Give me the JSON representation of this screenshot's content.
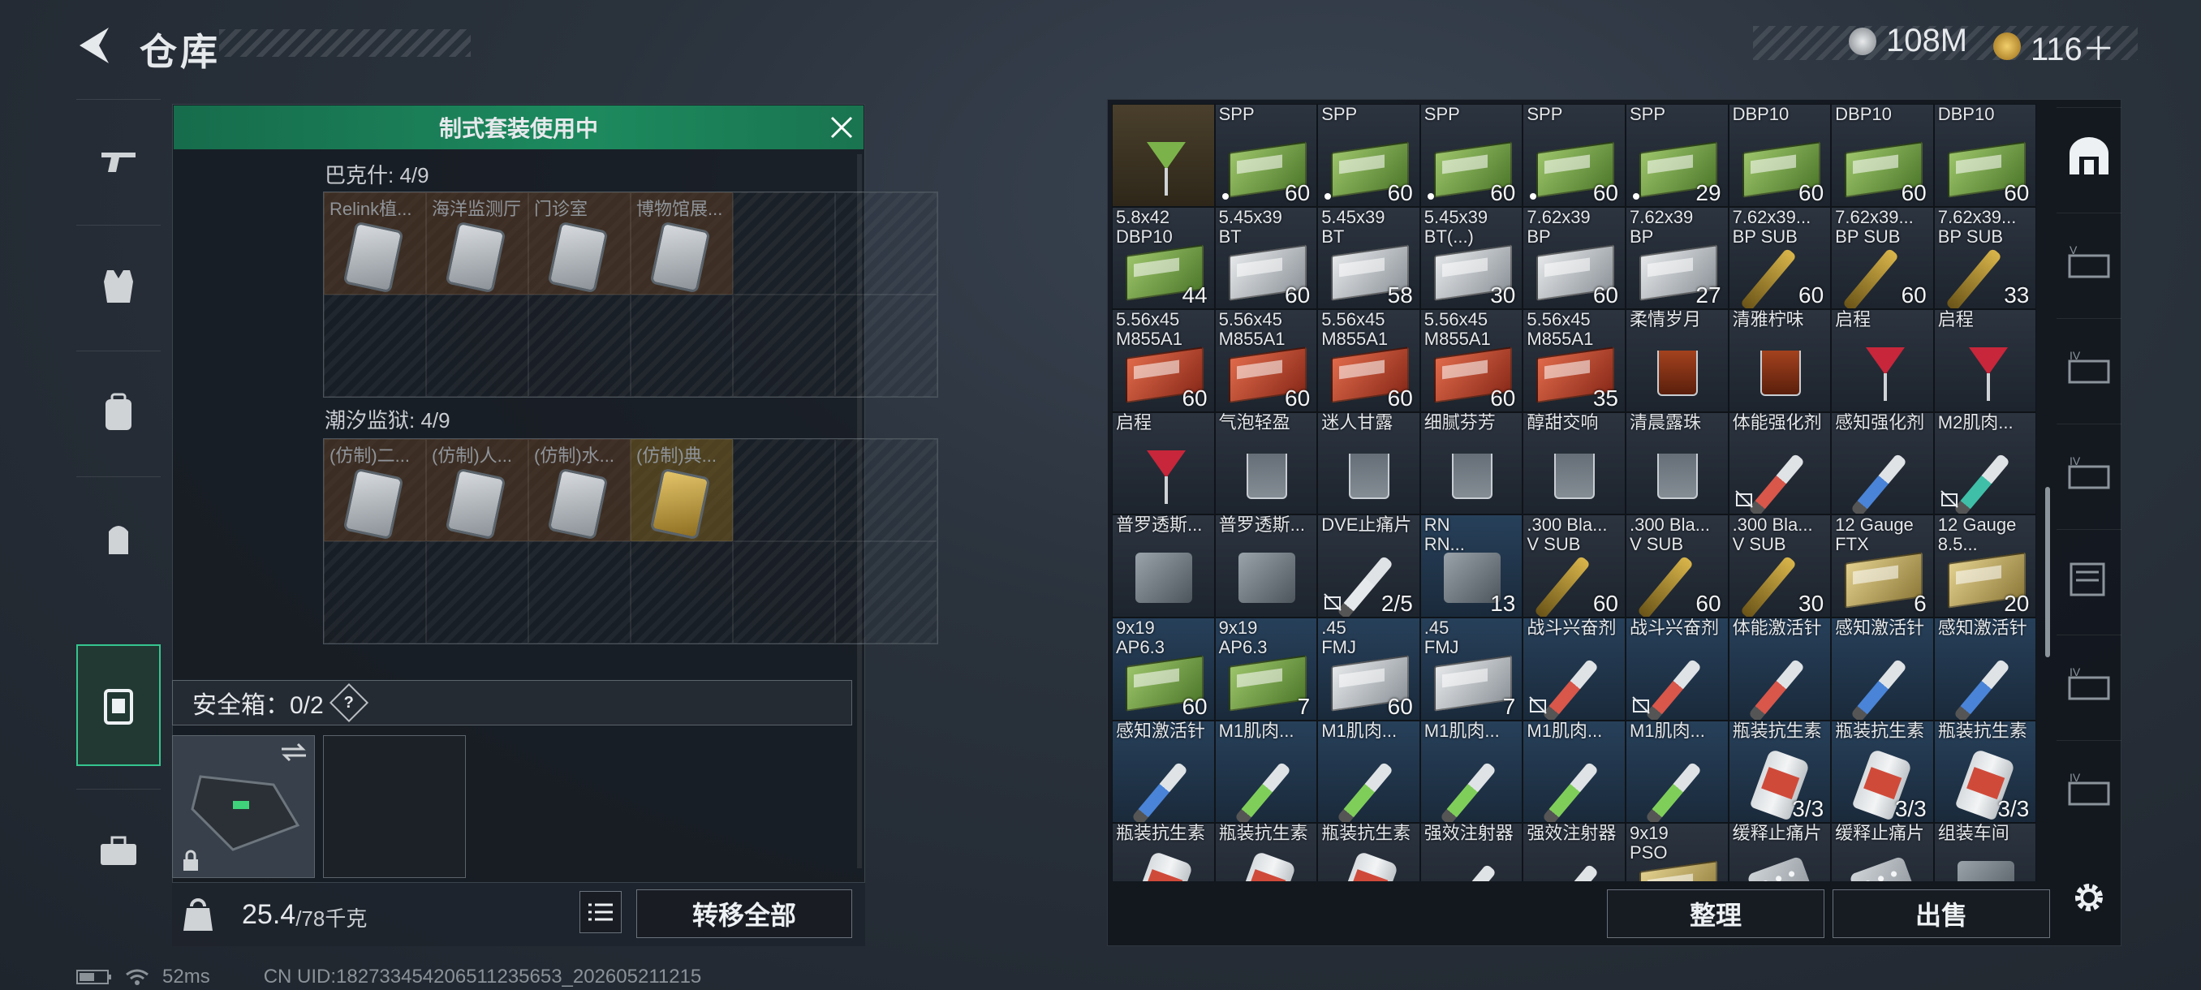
{
  "header": {
    "title": "仓库",
    "currency_silver": "108M",
    "currency_gold": "116＋"
  },
  "left_nav": [
    "gun-icon",
    "vest-icon",
    "backpack-icon",
    "pouch-icon",
    "secure-case-icon",
    "toolbox-icon"
  ],
  "kit_panel": {
    "title": "制式套装使用中",
    "set1": {
      "label": "巴克什: 4/9",
      "items": [
        "Relink植...",
        "海洋监测厅",
        "门诊室",
        "博物馆展..."
      ]
    },
    "set2": {
      "label": "潮汐监狱: 4/9",
      "items": [
        "(仿制)二...",
        "(仿制)人...",
        "(仿制)水...",
        "(仿制)典..."
      ]
    }
  },
  "safe_box": {
    "label": "安全箱：0/2",
    "help": "?"
  },
  "weight": {
    "current": "25.4",
    "max": "/78千克"
  },
  "buttons": {
    "transfer_all": "转移全部",
    "sort": "整理",
    "sell": "出售"
  },
  "grid": [
    {
      "n": "",
      "c": "",
      "t": "cocktail-green",
      "bg": "brown"
    },
    {
      "n": "SPP",
      "c": "60",
      "t": "ammo-green",
      "dot": true
    },
    {
      "n": "SPP",
      "c": "60",
      "t": "ammo-green",
      "dot": true
    },
    {
      "n": "SPP",
      "c": "60",
      "t": "ammo-green",
      "dot": true
    },
    {
      "n": "SPP",
      "c": "60",
      "t": "ammo-green",
      "dot": true
    },
    {
      "n": "SPP",
      "c": "29",
      "t": "ammo-green",
      "dot": true
    },
    {
      "n": "DBP10",
      "c": "60",
      "t": "ammo-green"
    },
    {
      "n": "DBP10",
      "c": "60",
      "t": "ammo-green"
    },
    {
      "n": "DBP10",
      "c": "60",
      "t": "ammo-green"
    },
    {
      "n": "5.8x42\nDBP10",
      "c": "44",
      "t": "ammo-green"
    },
    {
      "n": "5.45x39\nBT",
      "c": "60",
      "t": "ammo-white"
    },
    {
      "n": "5.45x39\nBT",
      "c": "58",
      "t": "ammo-white"
    },
    {
      "n": "5.45x39\nBT(...)",
      "c": "30",
      "t": "ammo-white"
    },
    {
      "n": "7.62x39\nBP",
      "c": "60",
      "t": "ammo-white"
    },
    {
      "n": "7.62x39\nBP",
      "c": "27",
      "t": "ammo-white"
    },
    {
      "n": "7.62x39...\nBP SUB",
      "c": "60",
      "t": "shell"
    },
    {
      "n": "7.62x39...\nBP SUB",
      "c": "60",
      "t": "shell"
    },
    {
      "n": "7.62x39...\nBP SUB",
      "c": "33",
      "t": "shell"
    },
    {
      "n": "5.56x45\nM855A1",
      "c": "60",
      "t": "ammo-red"
    },
    {
      "n": "5.56x45\nM855A1",
      "c": "60",
      "t": "ammo-red"
    },
    {
      "n": "5.56x45\nM855A1",
      "c": "60",
      "t": "ammo-red"
    },
    {
      "n": "5.56x45\nM855A1",
      "c": "60",
      "t": "ammo-red"
    },
    {
      "n": "5.56x45\nM855A1",
      "c": "35",
      "t": "ammo-red"
    },
    {
      "n": "柔情岁月",
      "c": "",
      "t": "tumbler-amber"
    },
    {
      "n": "清雅柠味",
      "c": "",
      "t": "tumbler-amber"
    },
    {
      "n": "启程",
      "c": "",
      "t": "cocktail"
    },
    {
      "n": "启程",
      "c": "",
      "t": "cocktail"
    },
    {
      "n": "启程",
      "c": "",
      "t": "cocktail"
    },
    {
      "n": "气泡轻盈",
      "c": "",
      "t": "tumbler"
    },
    {
      "n": "迷人甘露",
      "c": "",
      "t": "tumbler"
    },
    {
      "n": "细腻芬芳",
      "c": "",
      "t": "tumbler"
    },
    {
      "n": "醇甜交响",
      "c": "",
      "t": "tumbler"
    },
    {
      "n": "清晨露珠",
      "c": "",
      "t": "tumbler"
    },
    {
      "n": "体能强化剂",
      "c": "",
      "t": "syringe-red",
      "lock": true
    },
    {
      "n": "感知强化剂",
      "c": "",
      "t": "syringe-blue"
    },
    {
      "n": "M2肌肉...",
      "c": "",
      "t": "syringe-teal",
      "lock": true
    },
    {
      "n": "普罗透斯...",
      "c": "",
      "t": "generic"
    },
    {
      "n": "普罗透斯...",
      "c": "",
      "t": "generic"
    },
    {
      "n": "DVE止痛片",
      "c": "2/5",
      "t": "syringe-white",
      "lock": true
    },
    {
      "n": "RN\nRN...",
      "c": "13",
      "t": "generic",
      "bg": "blue"
    },
    {
      "n": ".300 Bla...\nV SUB",
      "c": "60",
      "t": "shell"
    },
    {
      "n": ".300 Bla...\nV SUB",
      "c": "60",
      "t": "shell"
    },
    {
      "n": ".300 Bla...\nV SUB",
      "c": "30",
      "t": "shell"
    },
    {
      "n": "12 Gauge\nFTX",
      "c": "6",
      "t": "ammo-tan"
    },
    {
      "n": "12 Gauge\n8.5...",
      "c": "20",
      "t": "ammo-tan"
    },
    {
      "n": "9x19\nAP6.3",
      "c": "60",
      "t": "ammo-green",
      "bg": "blue"
    },
    {
      "n": "9x19\nAP6.3",
      "c": "7",
      "t": "ammo-green",
      "bg": "blue"
    },
    {
      "n": ".45\nFMJ",
      "c": "60",
      "t": "ammo-white",
      "bg": "blue"
    },
    {
      "n": ".45\nFMJ",
      "c": "7",
      "t": "ammo-white",
      "bg": "blue"
    },
    {
      "n": "战斗兴奋剂",
      "c": "",
      "t": "syringe-red",
      "lock": true,
      "bg": "blue"
    },
    {
      "n": "战斗兴奋剂",
      "c": "",
      "t": "syringe-red",
      "lock": true,
      "bg": "blue"
    },
    {
      "n": "体能激活针",
      "c": "",
      "t": "syringe-red",
      "bg": "blue"
    },
    {
      "n": "感知激活针",
      "c": "",
      "t": "syringe-blue",
      "bg": "blue"
    },
    {
      "n": "感知激活针",
      "c": "",
      "t": "syringe-blue",
      "bg": "blue"
    },
    {
      "n": "感知激活针",
      "c": "",
      "t": "syringe-blue",
      "bg": "blue"
    },
    {
      "n": "M1肌肉...",
      "c": "",
      "t": "syringe-green",
      "bg": "blue"
    },
    {
      "n": "M1肌肉...",
      "c": "",
      "t": "syringe-green",
      "bg": "blue"
    },
    {
      "n": "M1肌肉...",
      "c": "",
      "t": "syringe-green",
      "bg": "blue"
    },
    {
      "n": "M1肌肉...",
      "c": "",
      "t": "syringe-green",
      "bg": "blue"
    },
    {
      "n": "M1肌肉...",
      "c": "",
      "t": "syringe-green",
      "bg": "blue"
    },
    {
      "n": "瓶装抗生素",
      "c": "3/3",
      "t": "bottle",
      "bg": "blue"
    },
    {
      "n": "瓶装抗生素",
      "c": "3/3",
      "t": "bottle",
      "bg": "blue"
    },
    {
      "n": "瓶装抗生素",
      "c": "3/3",
      "t": "bottle",
      "bg": "blue"
    },
    {
      "n": "瓶装抗生素",
      "c": "",
      "t": "bottle"
    },
    {
      "n": "瓶装抗生素",
      "c": "",
      "t": "bottle"
    },
    {
      "n": "瓶装抗生素",
      "c": "",
      "t": "bottle"
    },
    {
      "n": "强效注射器",
      "c": "",
      "t": "syringe-red"
    },
    {
      "n": "强效注射器",
      "c": "",
      "t": "syringe-red"
    },
    {
      "n": "9x19\nPSO",
      "c": "",
      "t": "ammo-tan"
    },
    {
      "n": "缓释止痛片",
      "c": "",
      "t": "pill"
    },
    {
      "n": "缓释止痛片",
      "c": "",
      "t": "pill"
    },
    {
      "n": "组装车间",
      "c": "",
      "t": "generic"
    }
  ],
  "right_nav": [
    "bunker-icon",
    "case-v-icon",
    "case-iv-icon",
    "case-iv-icon",
    "folder-icon",
    "case-iv-icon",
    "case-iv-icon"
  ],
  "status": {
    "ping": "52ms",
    "uid": "CN UID:182733454206511235653_202605211215"
  },
  "colors": {
    "accent_green": "#1d8a5e",
    "amber": "#c58a2c"
  }
}
